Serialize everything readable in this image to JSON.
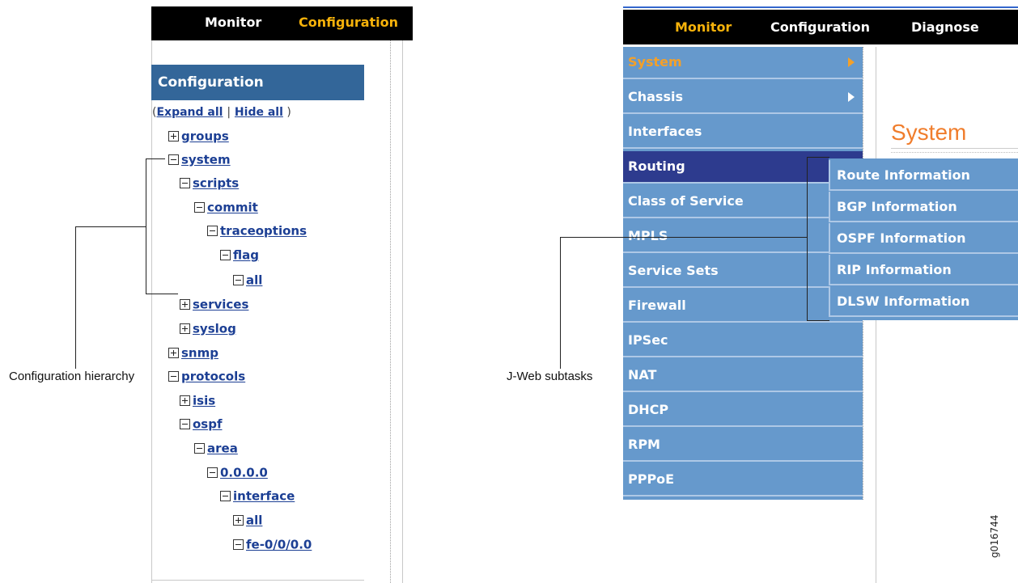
{
  "left": {
    "tabs": [
      "Monitor",
      "Configuration"
    ],
    "header": "Configuration",
    "expand": {
      "expand_all": "Expand all",
      "hide_all": "Hide all"
    },
    "tree": [
      {
        "label": "groups",
        "state": "plus"
      },
      {
        "label": "system",
        "state": "minus"
      },
      {
        "label": "scripts",
        "state": "minus"
      },
      {
        "label": "commit",
        "state": "minus"
      },
      {
        "label": "traceoptions",
        "state": "minus"
      },
      {
        "label": "flag",
        "state": "minus"
      },
      {
        "label": "all",
        "state": "minus"
      },
      {
        "label": "services",
        "state": "plus"
      },
      {
        "label": "syslog",
        "state": "plus"
      },
      {
        "label": "snmp",
        "state": "plus"
      },
      {
        "label": "protocols",
        "state": "minus"
      },
      {
        "label": "isis",
        "state": "plus"
      },
      {
        "label": "ospf",
        "state": "minus"
      },
      {
        "label": "area",
        "state": "minus"
      },
      {
        "label": "0.0.0.0",
        "state": "minus"
      },
      {
        "label": "interface",
        "state": "minus"
      },
      {
        "label": "all",
        "state": "plus"
      },
      {
        "label": "fe-0/0/0.0",
        "state": "minus"
      }
    ],
    "callout": "Configuration hierarchy"
  },
  "right": {
    "tabs": [
      "Monitor",
      "Configuration",
      "Diagnose"
    ],
    "menu": [
      "System",
      "Chassis",
      "Interfaces",
      "Routing",
      "Class of Service",
      "MPLS",
      "Service Sets",
      "Firewall",
      "IPSec",
      "NAT",
      "DHCP",
      "RPM",
      "PPPoE"
    ],
    "page_title": "System",
    "submenu": [
      "Route Information",
      "BGP Information",
      "OSPF Information",
      "RIP Information",
      "DLSW Information"
    ],
    "callout": "J-Web subtasks",
    "figure_id": "g016744"
  },
  "colors": {
    "accent_orange": "#f6b20a",
    "menu_blue": "#6699cc",
    "selected_blue": "#2d3b8e",
    "header_blue": "#336699",
    "link_blue": "#1c3f94"
  }
}
